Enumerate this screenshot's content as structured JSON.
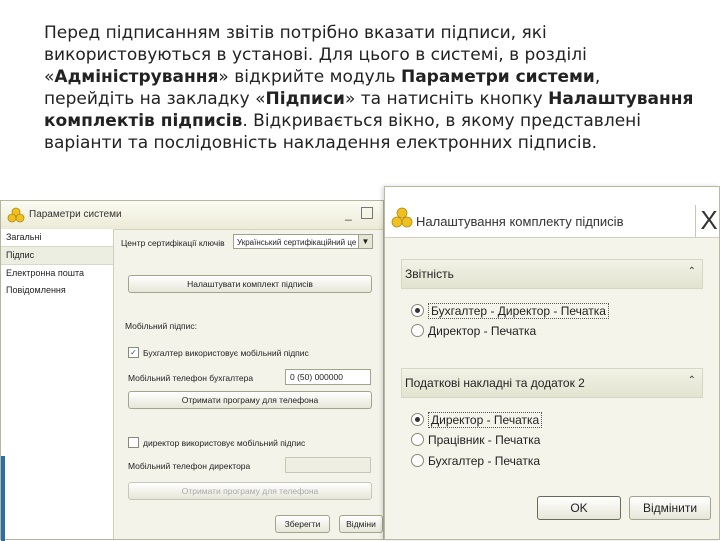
{
  "intro": {
    "p1": "Перед підписанням звітів потрібно вказати підписи, які використовуються в установі. Для цього в системі, в розділі «",
    "admin": "Адміністрування",
    "p2": "» відкрийте модуль ",
    "params": "Параметри системи",
    "p3": ", перейдіть на закладку «",
    "sign": "Підписи",
    "p4": "» та натисніть кнопку ",
    "setup": "Налаштування комплектів підписів",
    "p5": ". Відкривається вікно, в якому представлені варіанти та послідовність накладення електронних підписів."
  },
  "left_window": {
    "title": "Параметри системи",
    "min_glyph": "_",
    "sidebar": [
      "Загальні",
      "Підпис",
      "Електронна пошта",
      "Повідомлення"
    ],
    "ca_label": "Центр сертифікації ключів",
    "ca_value": "Український сертифікаційний це",
    "ca_arrow": "▼",
    "setup_button": "Налаштувати комплект підписів",
    "mobile_label": "Мобільний підпис:",
    "acc_check_label": "Бухгалтер використовує мобільний підпис",
    "acc_check_mark": "✓",
    "acc_phone_label": "Мобільний телефон бухгалтера",
    "acc_phone_value": "0 (50) 000000",
    "get_program_acc": "Отримати програму для телефона",
    "dir_check_label": "директор використовує мобільний підпис",
    "dir_phone_label": "Мобільний телефон директора",
    "get_program_dir": "Отримати програму для телефона",
    "save_button": "Зберегти",
    "cancel_button": "Відміни"
  },
  "right_window": {
    "title": "Налаштування комплекту підписів",
    "close_glyph": "X",
    "chevron": "⌃",
    "sections": [
      {
        "title": "Звітність",
        "options": [
          {
            "label": "Бухгалтер - Директор - Печатка",
            "selected": true
          },
          {
            "label": "Директор - Печатка",
            "selected": false
          }
        ]
      },
      {
        "title": "Податкові накладні та додаток 2",
        "options": [
          {
            "label": "Директор - Печатка",
            "selected": true
          },
          {
            "label": "Працівник - Печатка",
            "selected": false
          },
          {
            "label": "Бухгалтер - Печатка",
            "selected": false
          }
        ]
      }
    ],
    "ok_button": "OK",
    "cancel_button": "Відмінити"
  },
  "colors": {
    "logo_yellow": "#f0c020",
    "window_bg": "#f4f4ea"
  }
}
